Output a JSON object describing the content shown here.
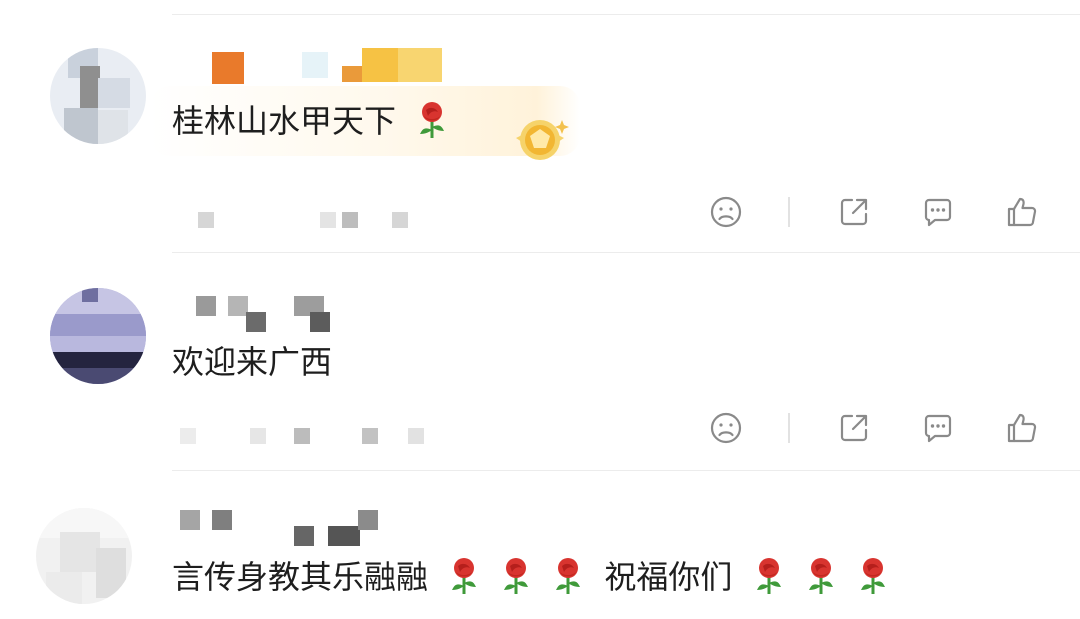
{
  "comments": [
    {
      "text": "桂林山水甲天下",
      "emoji_after": [
        "rose"
      ],
      "has_vip_medal": true,
      "actions": [
        "dislike-icon",
        "share-icon",
        "reply-icon",
        "like-icon"
      ]
    },
    {
      "text": "欢迎来广西",
      "emoji_after": [],
      "has_vip_medal": false,
      "actions": [
        "dislike-icon",
        "share-icon",
        "reply-icon",
        "like-icon"
      ]
    },
    {
      "text_part1": "言传身教其乐融融",
      "text_part2": "祝福你们",
      "emoji": "rose"
    }
  ],
  "colors": {
    "icon": "#8a8a8a",
    "divider": "#ececec",
    "rose": "#d8342f",
    "stem": "#3f9a3a",
    "medal": "#f2b632"
  }
}
